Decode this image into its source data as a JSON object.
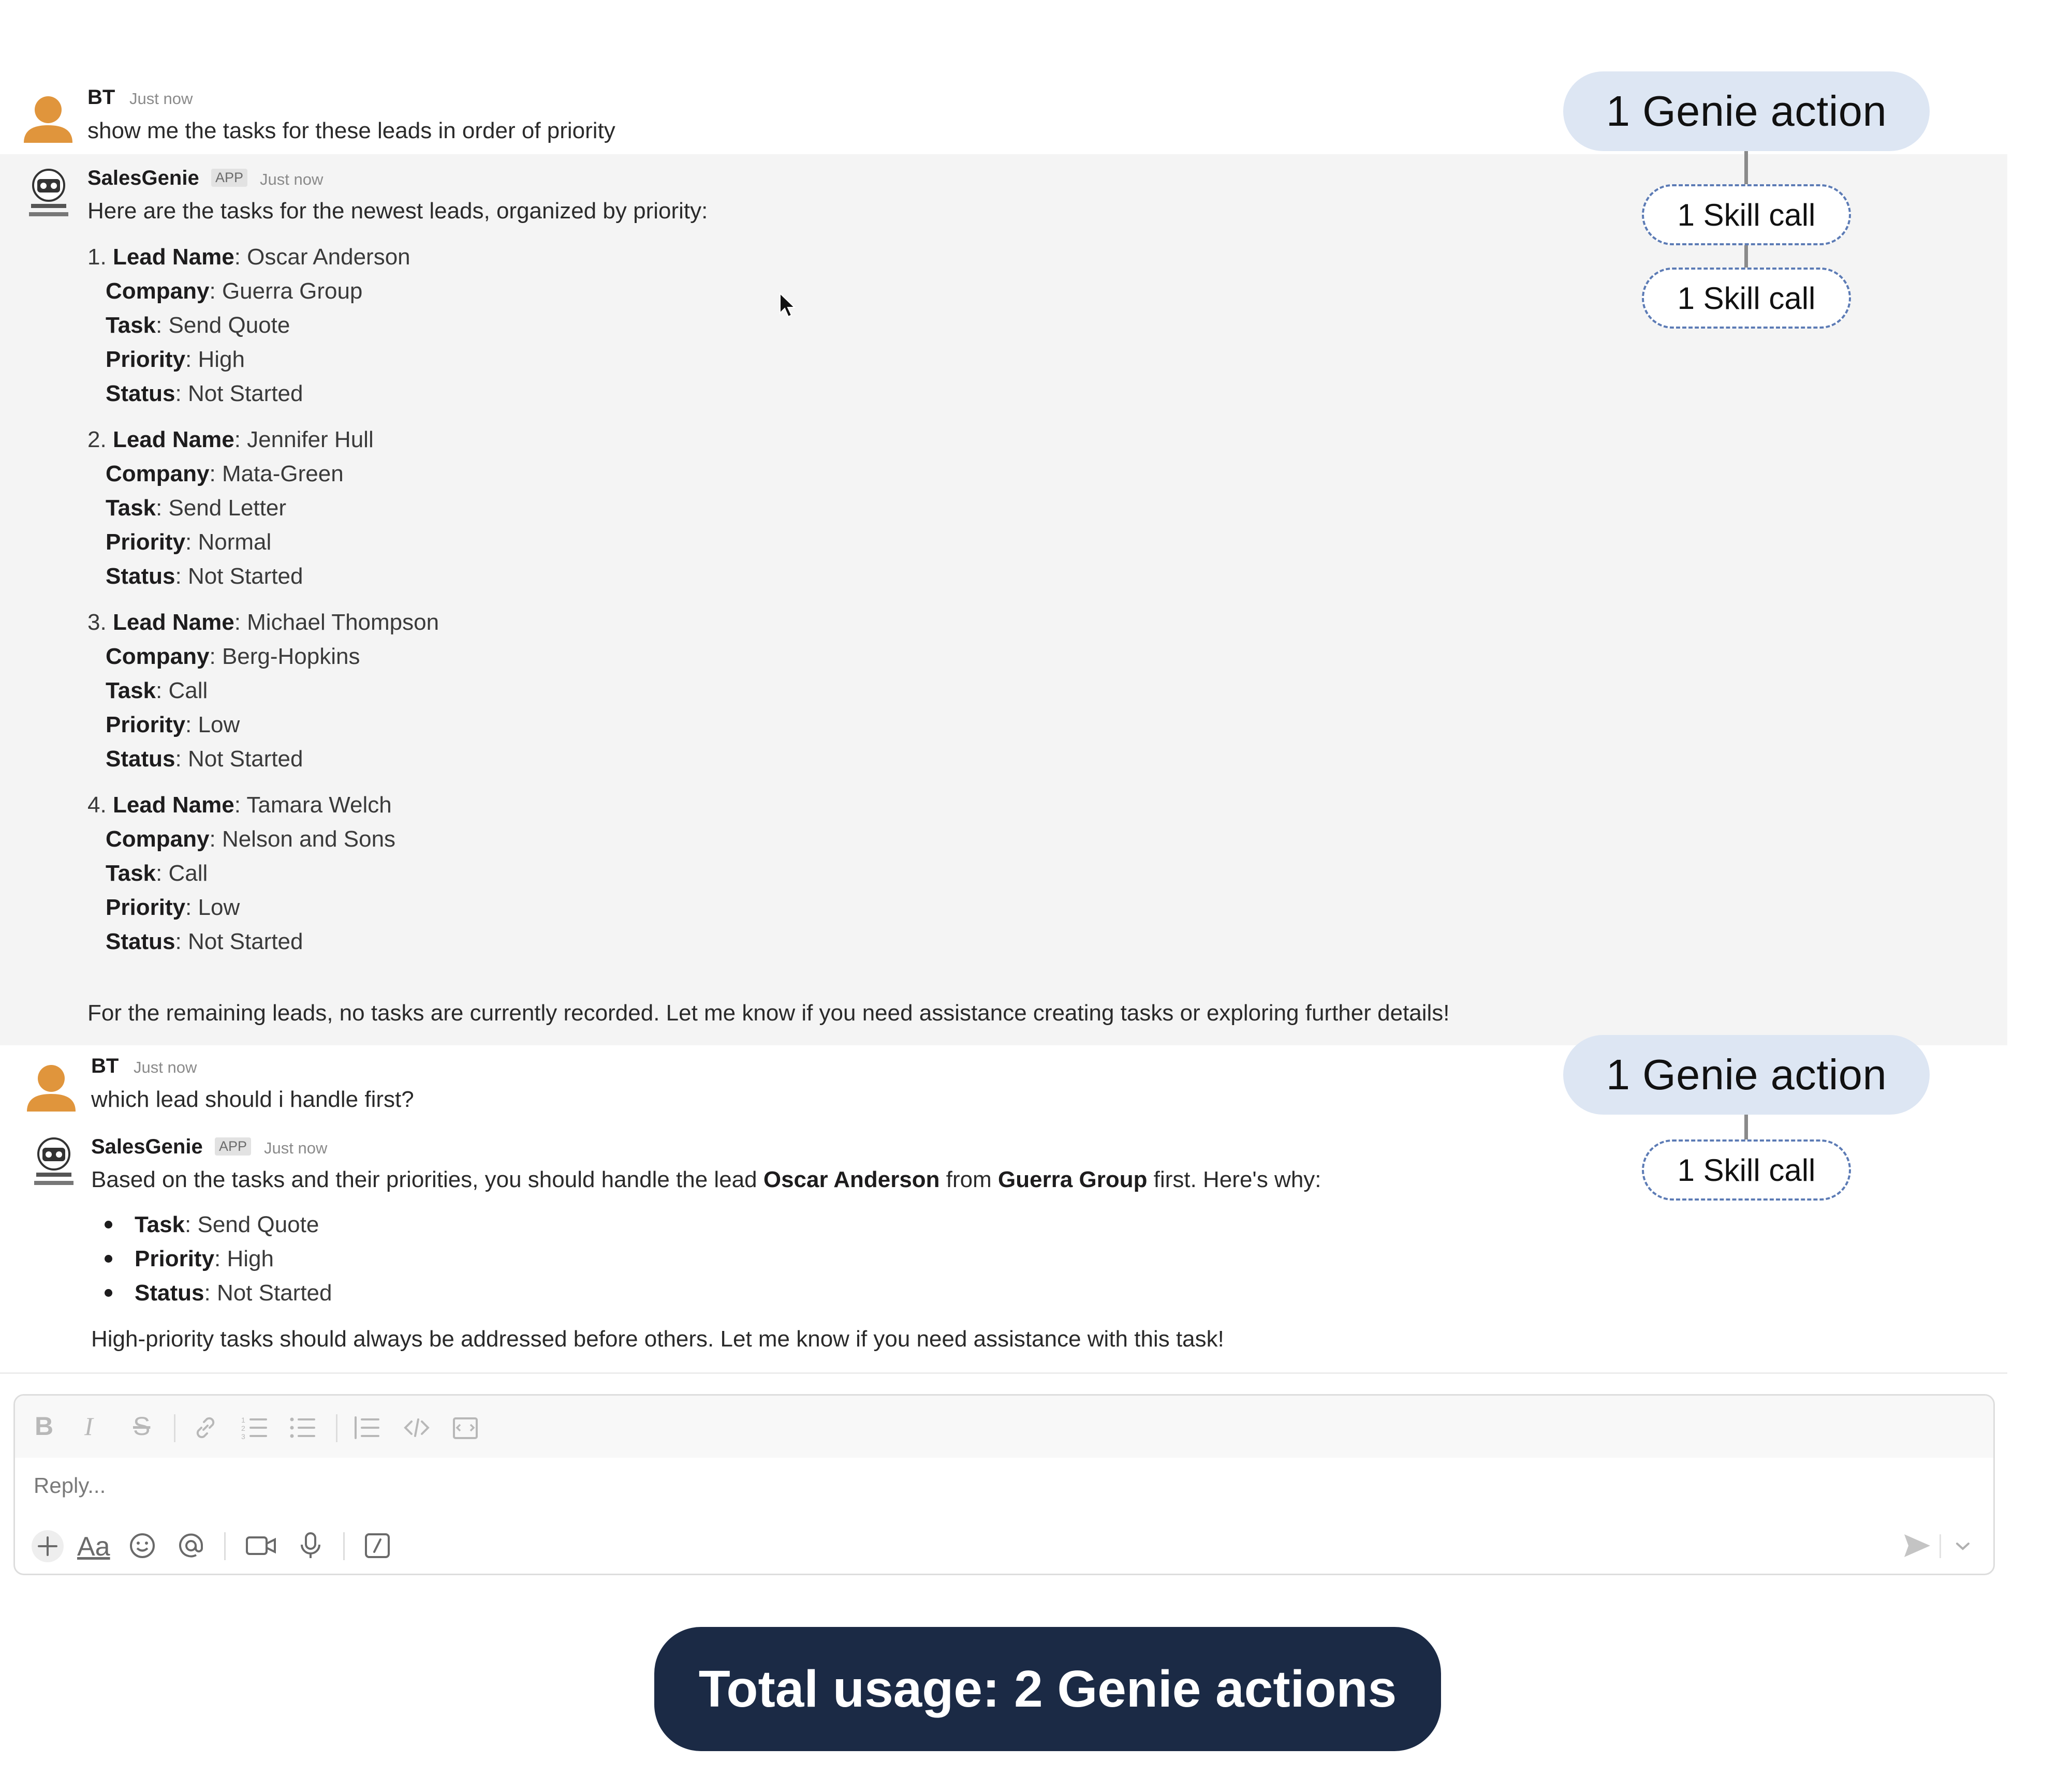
{
  "thread": {
    "msg1": {
      "author": "BT",
      "time": "Just now",
      "text": "show me the tasks for these leads in order of priority"
    },
    "msg2": {
      "author": "SalesGenie",
      "app_tag": "APP",
      "time": "Just now",
      "intro": "Here are the tasks for the newest leads, organized by priority:",
      "labels": {
        "lead": "Lead Name",
        "company": "Company",
        "task": "Task",
        "priority": "Priority",
        "status": "Status"
      },
      "items": [
        {
          "num": "1.",
          "lead": "Oscar Anderson",
          "company": "Guerra Group",
          "task": "Send Quote",
          "priority": "High",
          "status": "Not Started"
        },
        {
          "num": "2.",
          "lead": "Jennifer Hull",
          "company": "Mata-Green",
          "task": "Send Letter",
          "priority": "Normal",
          "status": "Not Started"
        },
        {
          "num": "3.",
          "lead": "Michael Thompson",
          "company": "Berg-Hopkins",
          "task": "Call",
          "priority": "Low",
          "status": "Not Started"
        },
        {
          "num": "4.",
          "lead": "Tamara Welch",
          "company": "Nelson and Sons",
          "task": "Call",
          "priority": "Low",
          "status": "Not Started"
        }
      ],
      "footer": "For the remaining leads, no tasks are currently recorded. Let me know if you need assistance creating tasks or exploring further details!"
    },
    "msg3": {
      "author": "BT",
      "time": "Just now",
      "text": "which lead should i handle first?"
    },
    "msg4": {
      "author": "SalesGenie",
      "app_tag": "APP",
      "time": "Just now",
      "text_parts": [
        "Based on the tasks and their priorities, you should handle the lead ",
        "Oscar Anderson",
        " from ",
        "Guerra Group",
        " first. Here's why:"
      ],
      "bullets": [
        {
          "key": "Task",
          "value": "Send Quote"
        },
        {
          "key": "Priority",
          "value": "High"
        },
        {
          "key": "Status",
          "value": "Not Started"
        }
      ],
      "footer": "High-priority tasks should always be addressed before others. Let me know if you need assistance with this task!"
    }
  },
  "annotations": {
    "group1": {
      "action": "1 Genie action",
      "skills": [
        "1 Skill call",
        "1 Skill call"
      ]
    },
    "group2": {
      "action": "1 Genie action",
      "skills": [
        "1 Skill call"
      ]
    }
  },
  "composer": {
    "placeholder": "Reply...",
    "format_buttons": [
      "B",
      "I",
      "S"
    ],
    "aa_label": "Aa"
  },
  "total_usage": "Total usage: 2 Genie actions"
}
